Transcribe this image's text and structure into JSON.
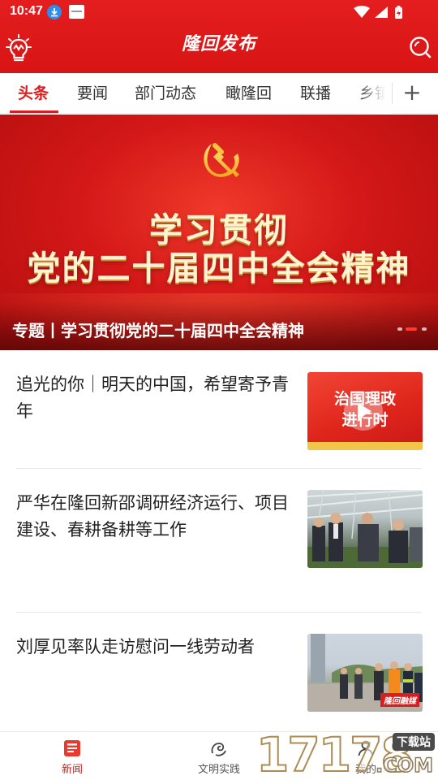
{
  "status_bar": {
    "time": "10:47"
  },
  "header": {
    "brand": "隆回发布"
  },
  "tabs": [
    {
      "label": "头条",
      "active": true
    },
    {
      "label": "要闻"
    },
    {
      "label": "部门动态"
    },
    {
      "label": "瞰隆回"
    },
    {
      "label": "联播"
    },
    {
      "label": "乡镇"
    }
  ],
  "add_tab_label": "+",
  "banner": {
    "line1": "学习贯彻",
    "line2": "党的二十届四中全会精神",
    "caption": "专题丨学习贯彻党的二十届四中全会精神",
    "slide_count": 3,
    "active_slide": 2
  },
  "feed": [
    {
      "title": "追光的你｜明天的中国，希望寄予青年",
      "thumb_text_1": "治国理政",
      "thumb_text_2": "进行时",
      "is_video": true
    },
    {
      "title": "严华在隆回新邵调研经济运行、项目建设、春耕备耕等工作"
    },
    {
      "title": "刘厚见率队走访慰问一线劳动者",
      "thumb_tag": "隆回融媒"
    }
  ],
  "bottom_nav": [
    {
      "label": "新闻",
      "icon": "news-icon",
      "active": true
    },
    {
      "label": "文明实践",
      "icon": "civilization-icon"
    },
    {
      "label": "我的",
      "icon": "profile-icon"
    }
  ],
  "watermark": {
    "digits": "17178",
    "tag": "下载站",
    "domain": ".COM"
  },
  "colors": {
    "brand_red": "#d81e1e",
    "header_red": "#e41e1e"
  }
}
